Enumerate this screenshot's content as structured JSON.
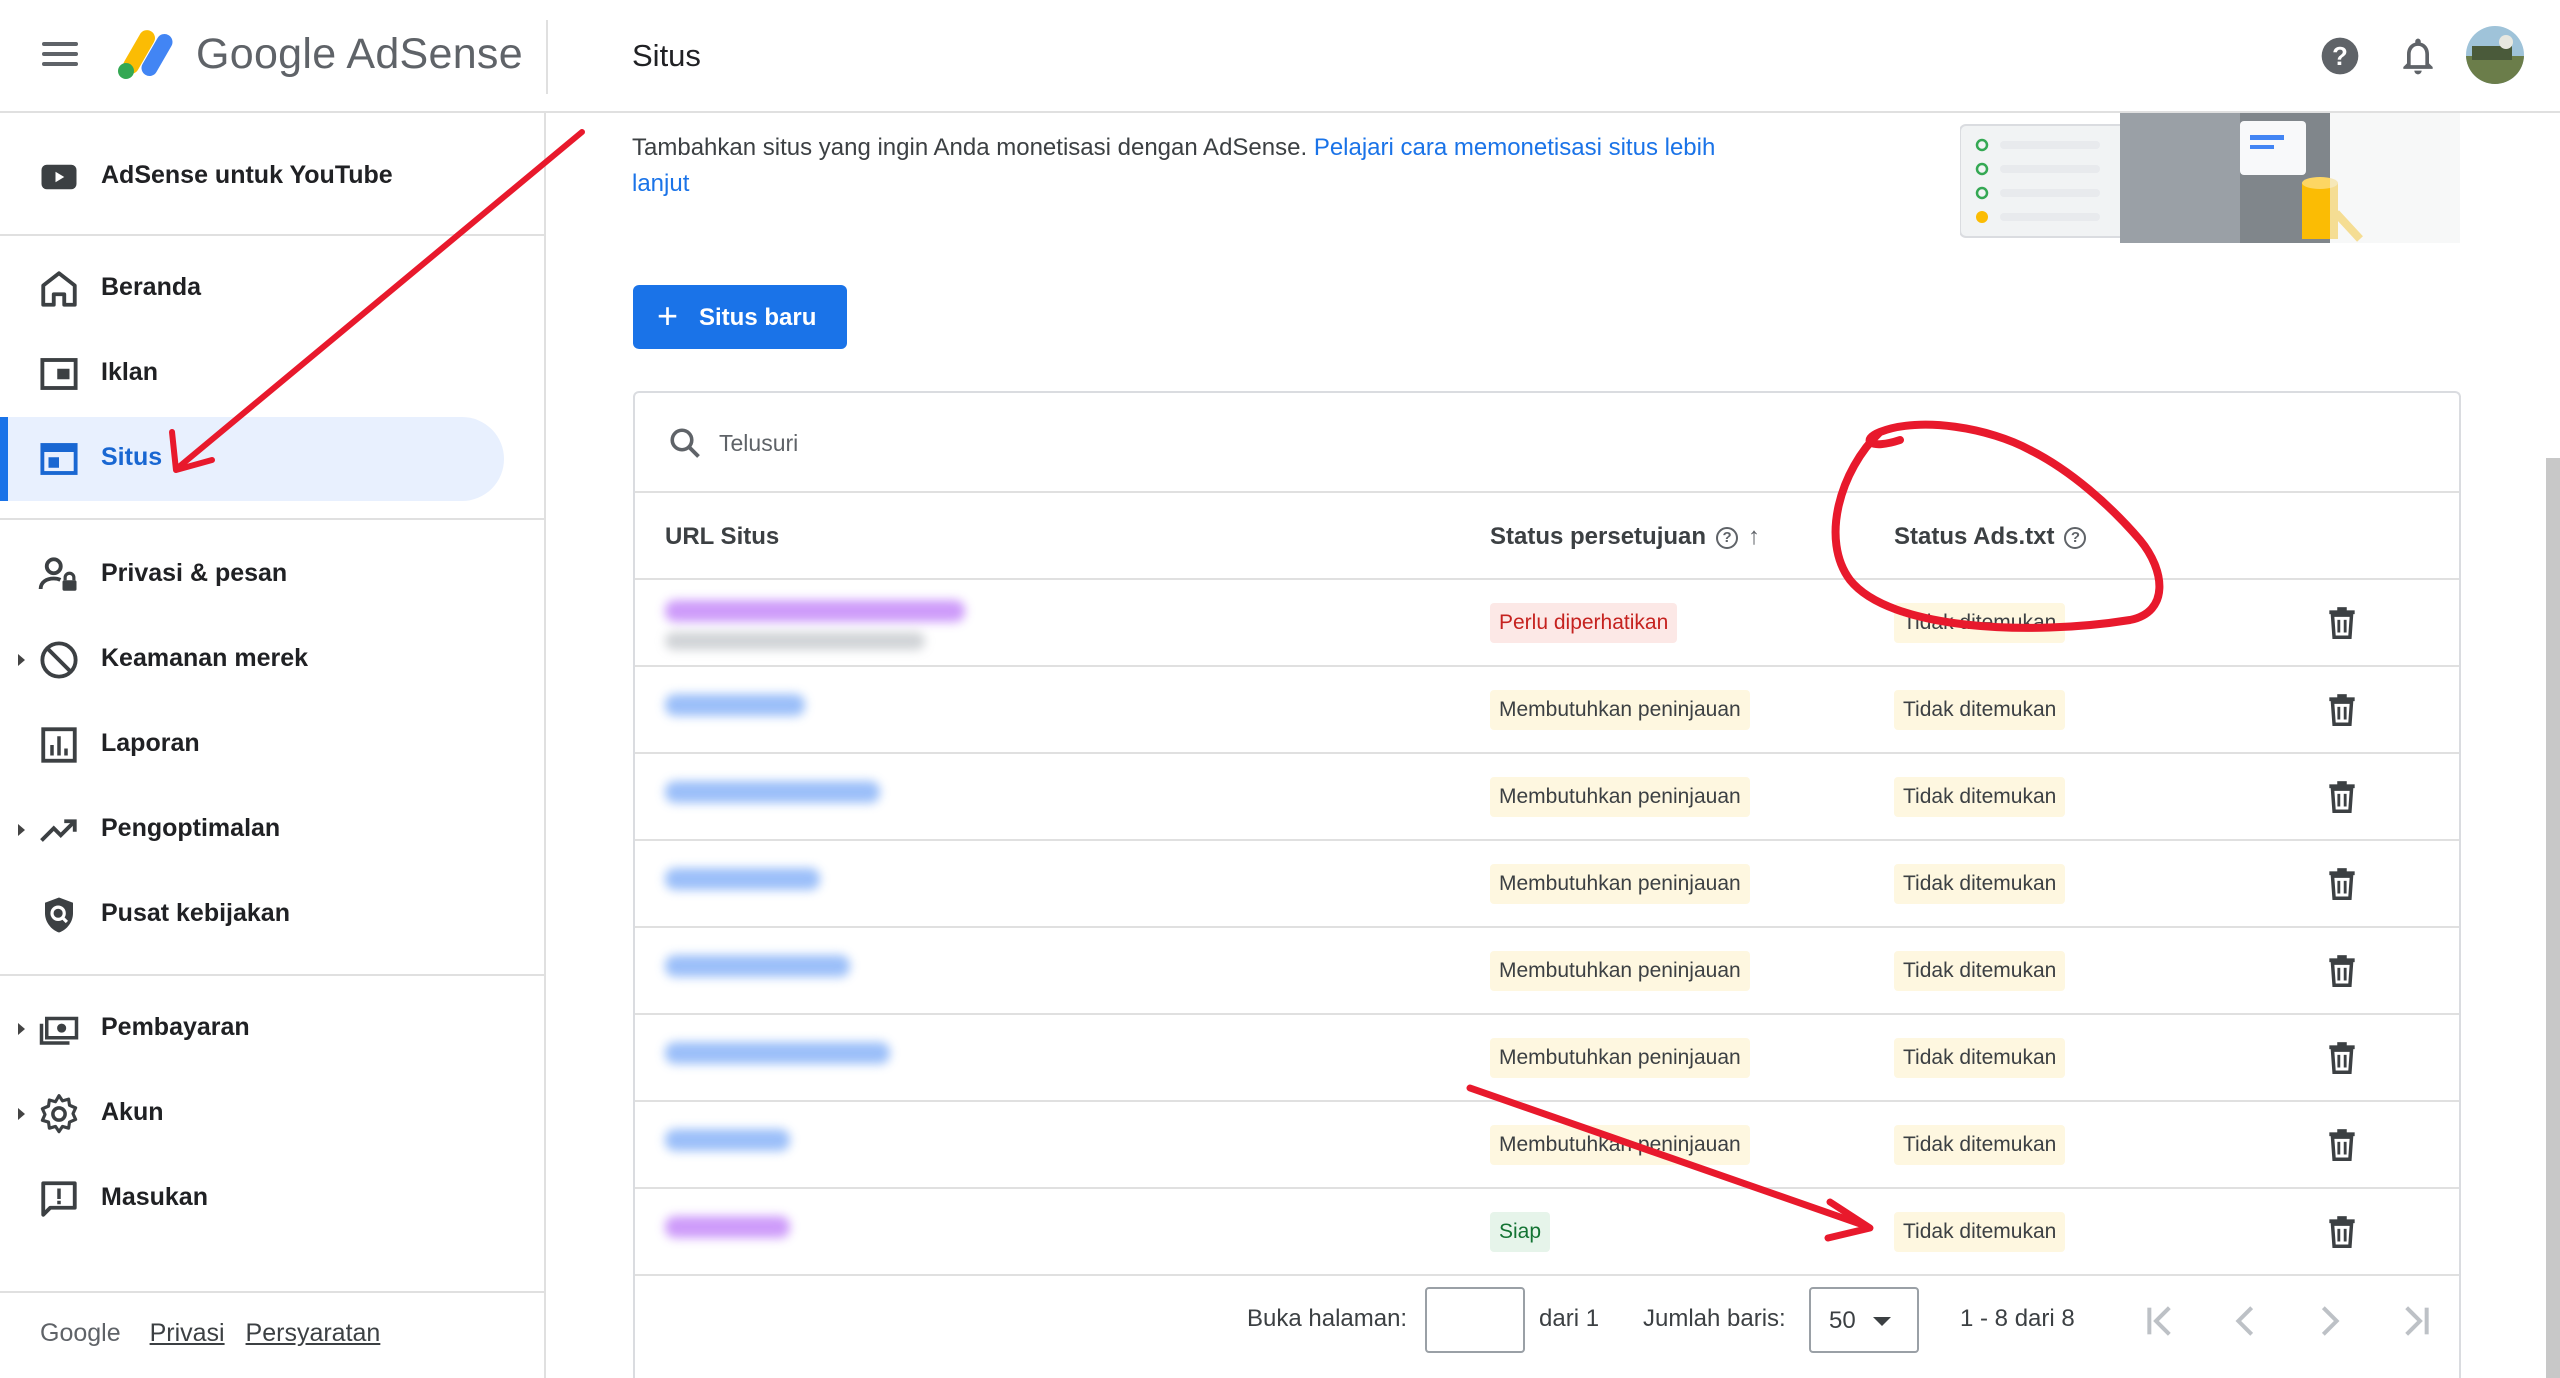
{
  "app": {
    "brand": "Google AdSense",
    "page_title": "Situs"
  },
  "sidebar": {
    "items": [
      {
        "label": "AdSense untuk YouTube",
        "icon": "youtube-icon"
      },
      {
        "label": "Beranda",
        "icon": "home-icon"
      },
      {
        "label": "Iklan",
        "icon": "ads-icon"
      },
      {
        "label": "Situs",
        "icon": "sites-icon",
        "active": true
      },
      {
        "label": "Privasi & pesan",
        "icon": "privacy-icon"
      },
      {
        "label": "Keamanan merek",
        "icon": "blocked-icon"
      },
      {
        "label": "Laporan",
        "icon": "reports-icon"
      },
      {
        "label": "Pengoptimalan",
        "icon": "trending-icon"
      },
      {
        "label": "Pusat kebijakan",
        "icon": "shield-icon"
      },
      {
        "label": "Pembayaran",
        "icon": "payments-icon"
      },
      {
        "label": "Akun",
        "icon": "gear-icon"
      },
      {
        "label": "Masukan",
        "icon": "feedback-icon"
      }
    ],
    "footer": {
      "google": "Google",
      "privacy": "Privasi",
      "terms": "Persyaratan"
    }
  },
  "intro": {
    "text": "Tambahkan situs yang ingin Anda monetisasi dengan AdSense.",
    "link": "Pelajari cara memonetisasi situs lebih lanjut"
  },
  "actions": {
    "new_site": "Situs baru"
  },
  "table": {
    "search_placeholder": "Telusuri",
    "columns": {
      "url": "URL Situs",
      "approval": "Status persetujuan",
      "adstxt": "Status Ads.txt"
    },
    "rows": [
      {
        "approval": "Perlu diperhatikan",
        "adstxt": "Tidak ditemukan"
      },
      {
        "approval": "Membutuhkan peninjauan",
        "adstxt": "Tidak ditemukan"
      },
      {
        "approval": "Membutuhkan peninjauan",
        "adstxt": "Tidak ditemukan"
      },
      {
        "approval": "Membutuhkan peninjauan",
        "adstxt": "Tidak ditemukan"
      },
      {
        "approval": "Membutuhkan peninjauan",
        "adstxt": "Tidak ditemukan"
      },
      {
        "approval": "Membutuhkan peninjauan",
        "adstxt": "Tidak ditemukan"
      },
      {
        "approval": "Membutuhkan peninjauan",
        "adstxt": "Tidak ditemukan"
      },
      {
        "approval": "Siap",
        "adstxt": "Tidak ditemukan"
      }
    ],
    "pager": {
      "go_to_page": "Buka halaman:",
      "of_pages": "dari 1",
      "rows_label": "Jumlah baris:",
      "rows_value": "50",
      "range": "1 - 8 dari 8"
    }
  },
  "colors": {
    "primary": "#1a73e8",
    "active_bg": "#e8f0fe",
    "annotation": "#e8192c"
  }
}
